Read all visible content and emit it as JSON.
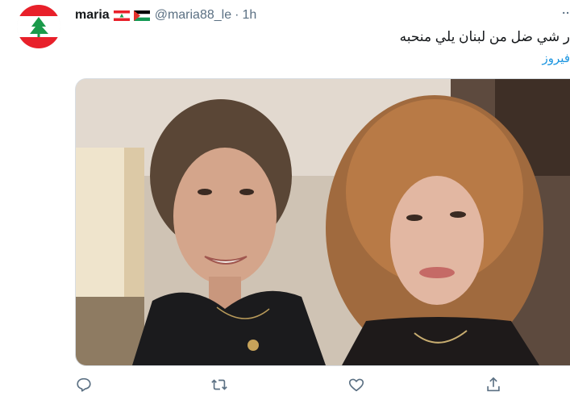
{
  "tweet": {
    "author_name": "maria",
    "handle": "@maria88_le",
    "separator": "·",
    "time": "1h",
    "more_label": "..",
    "text_line1": "ر شي ضل من لبنان يلي منحبه",
    "text_line2": "فيروز"
  },
  "icons": {
    "reply": "reply-icon",
    "retweet": "retweet-icon",
    "like": "heart-icon",
    "share": "share-icon"
  },
  "colors": {
    "link": "#1b95e0",
    "muted": "#5b7083",
    "lebanon_red": "#e8202a",
    "cedar_green": "#1a9a4a"
  }
}
